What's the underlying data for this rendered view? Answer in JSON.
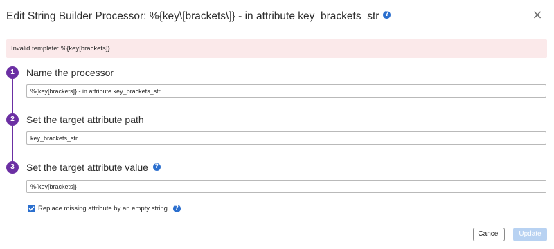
{
  "header": {
    "title": "Edit String Builder Processor: %{key\\[brackets\\]} - in attribute key_brackets_str",
    "help_icon": "?",
    "close_icon": "×"
  },
  "error": {
    "message": "Invalid template: %{key[brackets]}"
  },
  "steps": [
    {
      "number": "1",
      "label": "Name the processor",
      "value": "%{key[brackets]} - in attribute key_brackets_str"
    },
    {
      "number": "2",
      "label": "Set the target attribute path",
      "value": "key_brackets_str"
    },
    {
      "number": "3",
      "label": "Set the target attribute value",
      "value": "%{key[brackets]}",
      "help_icon": "?"
    }
  ],
  "checkbox": {
    "label": "Replace missing attribute by an empty string",
    "checked": true,
    "help_icon": "?"
  },
  "footer": {
    "cancel_label": "Cancel",
    "update_label": "Update"
  },
  "colors": {
    "step_accent": "#6b2fa3",
    "help_icon": "#2b6fce",
    "error_bg": "#fbe9ea",
    "update_disabled": "#b8d2f2"
  }
}
